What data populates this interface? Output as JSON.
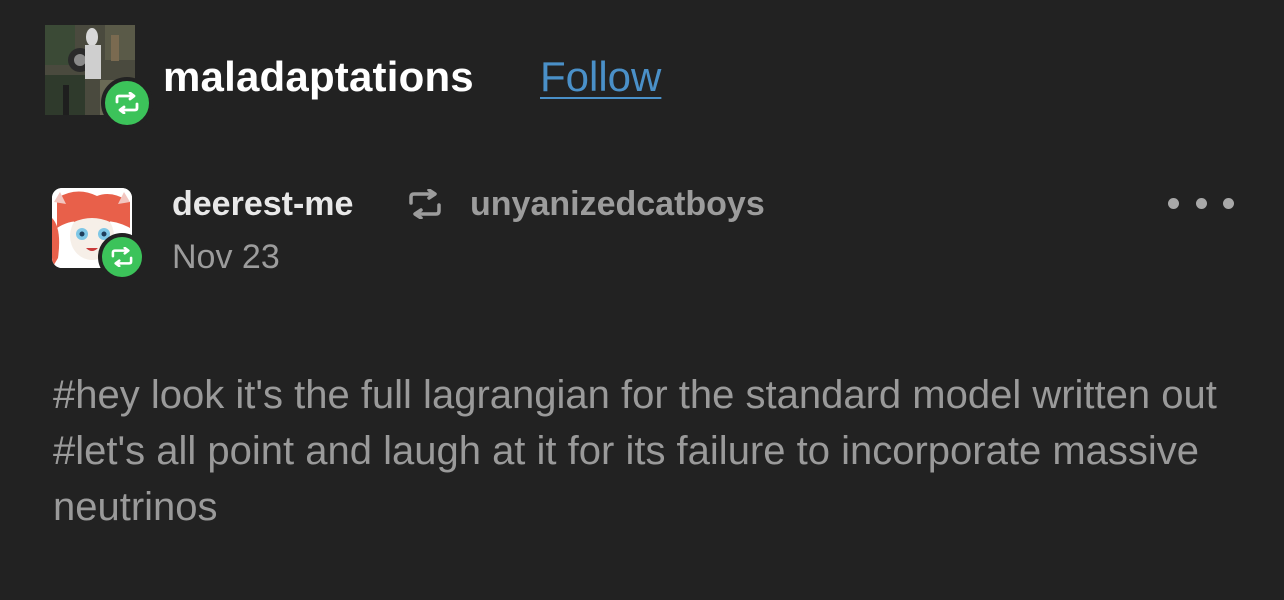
{
  "reblogger": {
    "name": "maladaptations",
    "follow_label": "Follow"
  },
  "post": {
    "author": "deerest-me",
    "source": "unyanizedcatboys",
    "date": "Nov 23",
    "tags": [
      "#hey look it's the full lagrangian for the standard model written out",
      "#let's all point and laugh at it for its failure to incorporate massive neutrinos"
    ]
  },
  "colors": {
    "background": "#222222",
    "follow_link": "#4a90c8",
    "reblog_badge": "#3cc35a",
    "muted_text": "#9c9c9c"
  },
  "icons": {
    "reblog": "reblog-icon",
    "more": "ellipsis-icon"
  }
}
